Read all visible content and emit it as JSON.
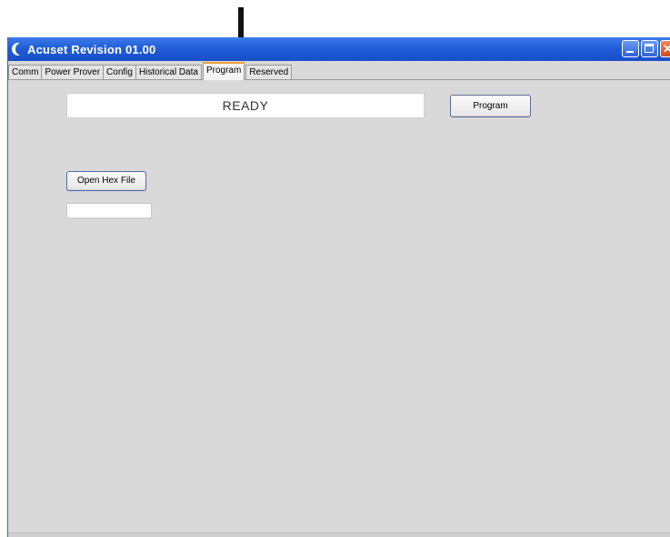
{
  "window": {
    "title": "Acuset Revision 01.00",
    "controls": [
      "minimize-icon",
      "maximize-icon",
      "close-icon"
    ]
  },
  "tabs": [
    {
      "label": "Comm",
      "active": false
    },
    {
      "label": "Power Prover",
      "active": false
    },
    {
      "label": "Config",
      "active": false
    },
    {
      "label": "Historical Data",
      "active": false
    },
    {
      "label": "Program",
      "active": true
    },
    {
      "label": "Reserved",
      "active": false
    }
  ],
  "program_panel": {
    "status_text": "READY",
    "program_button_label": "Program",
    "open_hex_button_label": "Open Hex File",
    "hex_file_path": ""
  },
  "annotation": {
    "icon": "down-arrow-icon",
    "color": "#111111"
  },
  "colors": {
    "titlebar": "#1e5bd6",
    "active_tab_accent": "#e8a13a",
    "panel_background": "#d9d9d9"
  }
}
